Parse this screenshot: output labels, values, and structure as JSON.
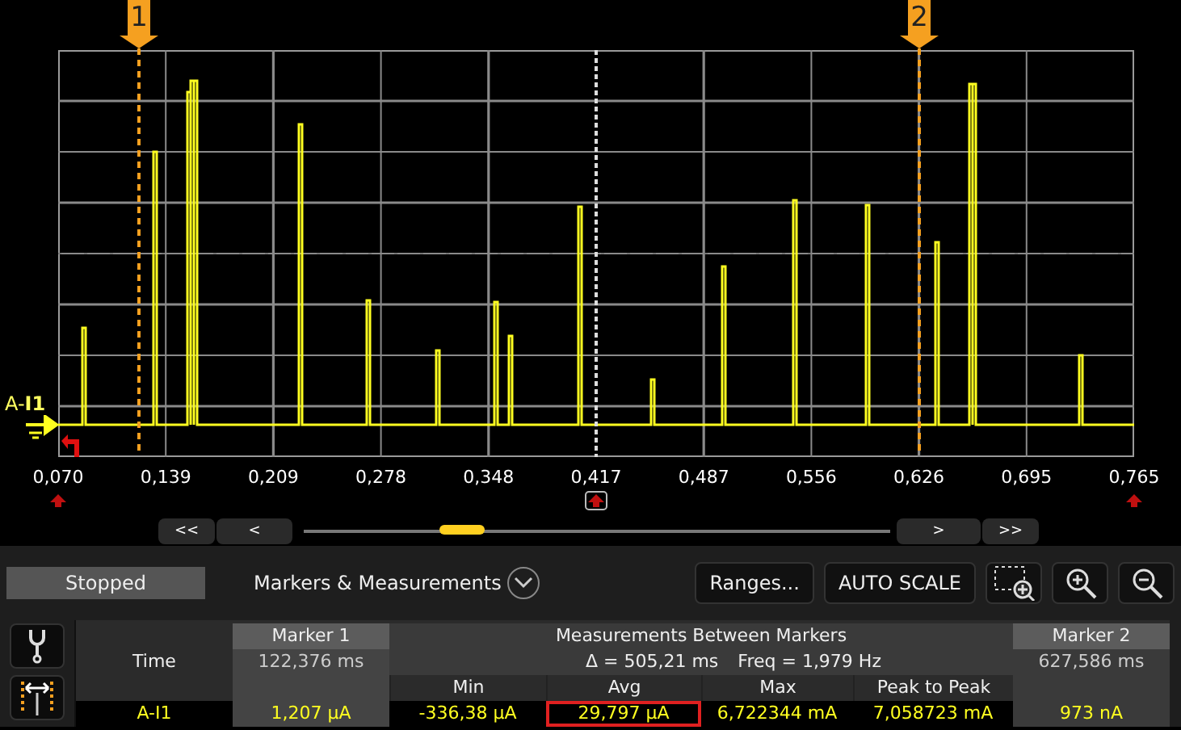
{
  "chart": {
    "channel_label": "A-**I1**",
    "markers": [
      {
        "label": "1"
      },
      {
        "label": "2"
      }
    ],
    "x_ticks": [
      "0,070",
      "0,139",
      "0,209",
      "0,278",
      "0,348",
      "0,417",
      "0,487",
      "0,556",
      "0,626",
      "0,695",
      "0,765"
    ]
  },
  "navigation": {
    "buttons": [
      "<<",
      "<",
      ">",
      ">>"
    ]
  },
  "status": "Stopped",
  "panel_title": "Markers & Measurements",
  "toolbar": {
    "buttons": [
      {
        "kind": "text",
        "label": "Ranges..."
      },
      {
        "kind": "text",
        "label": "AUTO SCALE"
      },
      {
        "kind": "zoom-box"
      },
      {
        "kind": "zoom-in"
      },
      {
        "kind": "zoom-out"
      }
    ]
  },
  "table": {
    "marker_1_header": "Marker 1",
    "between_header": "Measurements Between Markers",
    "marker_2_header": "Marker 2",
    "time_label": "Time",
    "marker_1_time": "122,376 ms",
    "delta": "Δ = 505,21 ms",
    "freq": "Freq = 1,979 Hz",
    "marker_2_time": "627,586 ms",
    "columns": [
      "Min",
      "Avg",
      "Max",
      "Peak to Peak"
    ],
    "row": {
      "label": "A-I1",
      "marker_1": "1,207 µA",
      "values": [
        {
          "text": "-336,38 µA",
          "highlighted": false
        },
        {
          "text": "29,797 µA",
          "highlighted": true
        },
        {
          "text": "6,722344 mA",
          "highlighted": false
        },
        {
          "text": "7,058723 mA",
          "highlighted": false
        }
      ],
      "marker_2": "973 nA"
    }
  }
}
